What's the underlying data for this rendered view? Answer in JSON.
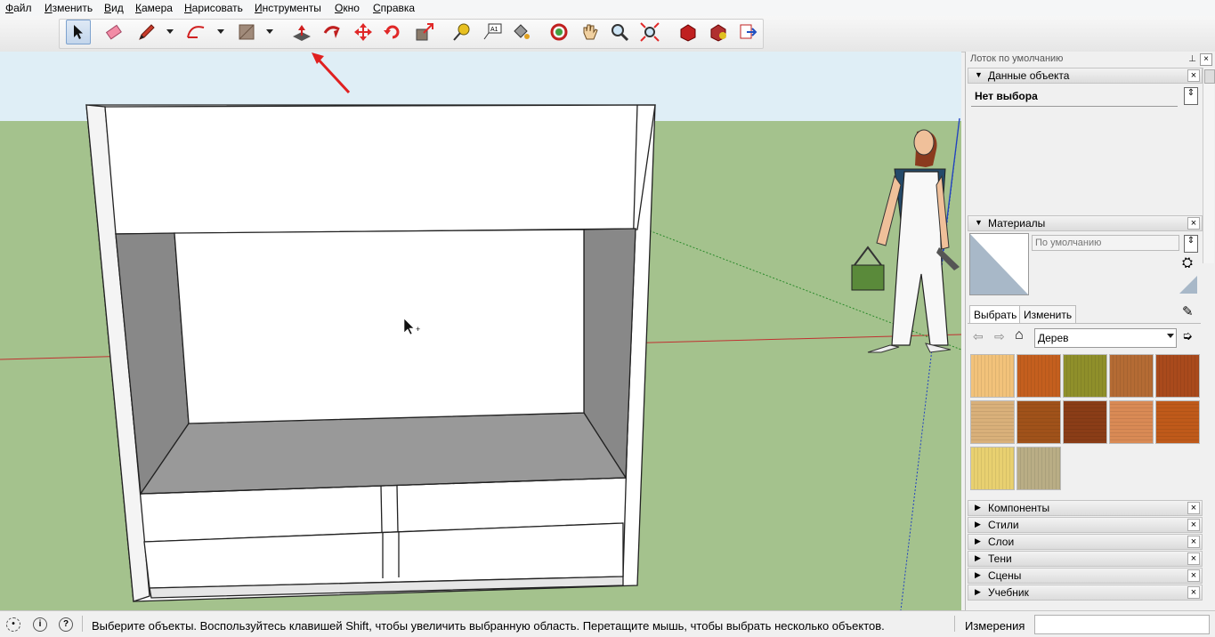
{
  "menu": [
    "Файл",
    "Изменить",
    "Вид",
    "Камера",
    "Нарисовать",
    "Инструменты",
    "Окно",
    "Справка"
  ],
  "menu_underline": [
    "Ф",
    "И",
    "В",
    "К",
    "Н",
    "И",
    "О",
    "С"
  ],
  "toolbar": {
    "tools": [
      "select-tool",
      "eraser-tool",
      "pencil-tool",
      "arc-tool",
      "shape-tool",
      "push-pull-tool",
      "follow-me-tool",
      "move-tool",
      "rotate-tool",
      "scale-tool",
      "tape-measure-tool",
      "text-tool",
      "paint-bucket-tool",
      "orbit-tool",
      "pan-tool",
      "zoom-tool",
      "zoom-extents-tool",
      "warehouse-tool",
      "extension-warehouse-tool",
      "send-to-layout-tool"
    ],
    "active_tool": "select-tool",
    "highlighted_tool": "push-pull-tool"
  },
  "tray": {
    "title": "Лоток по умолчанию",
    "entity_info": {
      "title": "Данные объекта",
      "no_selection": "Нет выбора"
    },
    "materials": {
      "title": "Материалы",
      "name_placeholder": "По умолчанию",
      "tabs": [
        "Выбрать",
        "Изменить"
      ],
      "collection": "Дерев",
      "swatch_colors": [
        "#f2c27a",
        "#c45f1e",
        "#8f8f2a",
        "#b46b34",
        "#a94a1c",
        "#d9b07a",
        "#a0521a",
        "#8a3d17",
        "#d98a55",
        "#bf5a1a",
        "#e8d070",
        "#b9ad85"
      ]
    },
    "collapsed_sections": [
      "Компоненты",
      "Стили",
      "Слои",
      "Тени",
      "Сцены",
      "Учебник"
    ]
  },
  "status": {
    "hint": "Выберите объекты. Воспользуйтесь клавишей Shift, чтобы увеличить выбранную область. Перетащите мышь, чтобы выбрать несколько объектов.",
    "measurements_label": "Измерения",
    "measurements_value": ""
  },
  "colors": {
    "sky": "#dfeef6",
    "ground": "#a4c28d",
    "annotation_arrow": "#e02020"
  }
}
